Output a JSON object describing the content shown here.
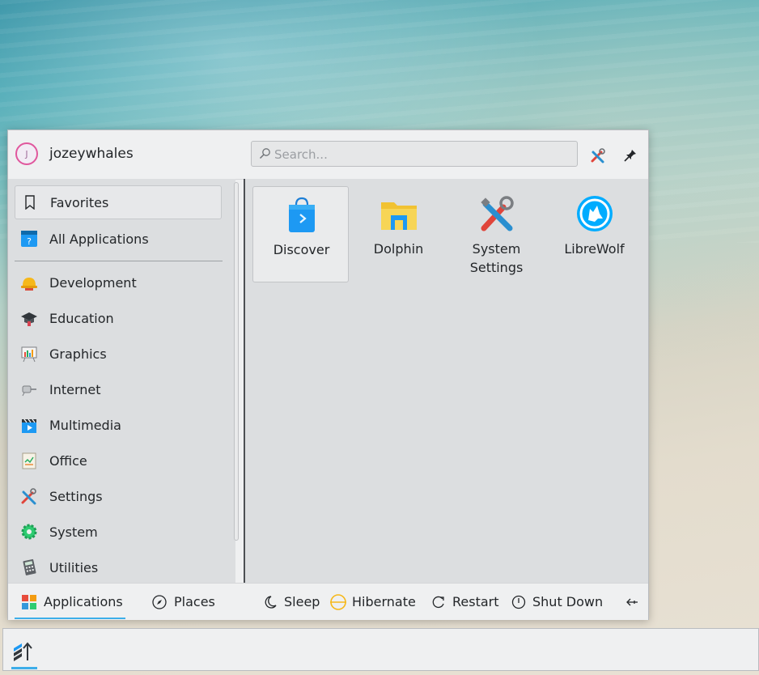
{
  "header": {
    "avatar_initial": "J",
    "username": "jozeywhales",
    "search_placeholder": "Search..."
  },
  "sidebar": {
    "items": [
      {
        "label": "Favorites",
        "icon": "bookmark-icon",
        "selected": true
      },
      {
        "label": "All Applications",
        "icon": "all-apps-icon"
      },
      {
        "label": "Development",
        "icon": "hard-hat-icon"
      },
      {
        "label": "Education",
        "icon": "graduation-cap-icon"
      },
      {
        "label": "Graphics",
        "icon": "easel-chart-icon"
      },
      {
        "label": "Internet",
        "icon": "network-plug-icon"
      },
      {
        "label": "Multimedia",
        "icon": "clapperboard-icon"
      },
      {
        "label": "Office",
        "icon": "office-document-icon"
      },
      {
        "label": "Settings",
        "icon": "tools-icon"
      },
      {
        "label": "System",
        "icon": "gear-icon"
      },
      {
        "label": "Utilities",
        "icon": "calculator-icon"
      }
    ]
  },
  "apps": [
    {
      "label": "Discover",
      "icon": "shopping-bag-icon"
    },
    {
      "label": "Dolphin",
      "icon": "folder-icon"
    },
    {
      "label": "System Settings",
      "icon": "tools-icon"
    },
    {
      "label": "LibreWolf",
      "icon": "librewolf-icon"
    }
  ],
  "footer": {
    "tabs": [
      {
        "label": "Applications",
        "icon": "apps-grid-icon",
        "active": true
      },
      {
        "label": "Places",
        "icon": "compass-icon"
      }
    ],
    "power": [
      {
        "label": "Sleep",
        "icon": "moon-icon"
      },
      {
        "label": "Hibernate",
        "icon": "hibernate-icon"
      },
      {
        "label": "Restart",
        "icon": "restart-icon"
      },
      {
        "label": "Shut Down",
        "icon": "power-icon"
      }
    ],
    "more_icon": "leave-arrow-icon"
  },
  "colors": {
    "accent": "#3daee9",
    "panel_bg": "#eff0f1",
    "content_bg": "#dcdee0",
    "avatar_ring": "#e0579d"
  }
}
